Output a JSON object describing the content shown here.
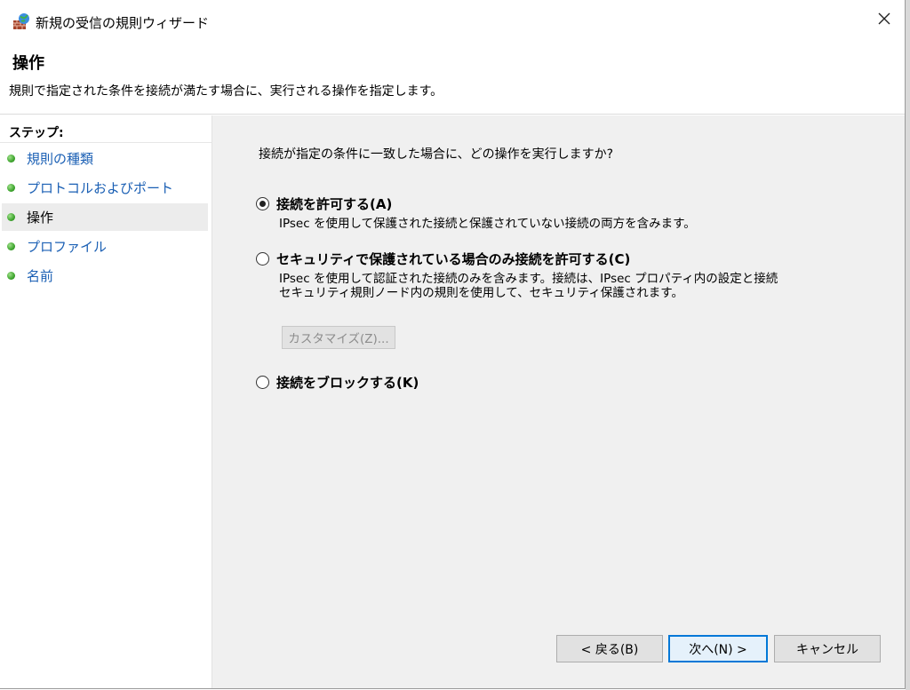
{
  "window": {
    "title": "新規の受信の規則ウィザード",
    "heading": "操作",
    "description": "規則で指定された条件を接続が満たす場合に、実行される操作を指定します。"
  },
  "steps": {
    "label": "ステップ:",
    "items": [
      {
        "label": "規則の種類",
        "active": false
      },
      {
        "label": "プロトコルおよびポート",
        "active": false
      },
      {
        "label": "操作",
        "active": true
      },
      {
        "label": "プロファイル",
        "active": false
      },
      {
        "label": "名前",
        "active": false
      }
    ]
  },
  "content": {
    "question": "接続が指定の条件に一致した場合に、どの操作を実行しますか?",
    "options": {
      "allow": {
        "label": "接続を許可する(A)",
        "description": "IPsec を使用して保護された接続と保護されていない接続の両方を含みます。",
        "checked": true
      },
      "allow_secure": {
        "label": "セキュリティで保護されている場合のみ接続を許可する(C)",
        "description_line1": "IPsec を使用して認証された接続のみを含みます。接続は、IPsec プロパティ内の設定と接続",
        "description_line2": "セキュリティ規則ノード内の規則を使用して、セキュリティ保護されます。",
        "checked": false
      },
      "block": {
        "label": "接続をブロックする(K)",
        "checked": false
      }
    },
    "customize_label": "カスタマイズ(Z)..."
  },
  "buttons": {
    "back": "< 戻る(B)",
    "next": "次へ(N) >",
    "cancel": "キャンセル"
  },
  "icons": {
    "app": "firewall-icon",
    "close": "close-icon",
    "step": "green-dot-icon"
  }
}
